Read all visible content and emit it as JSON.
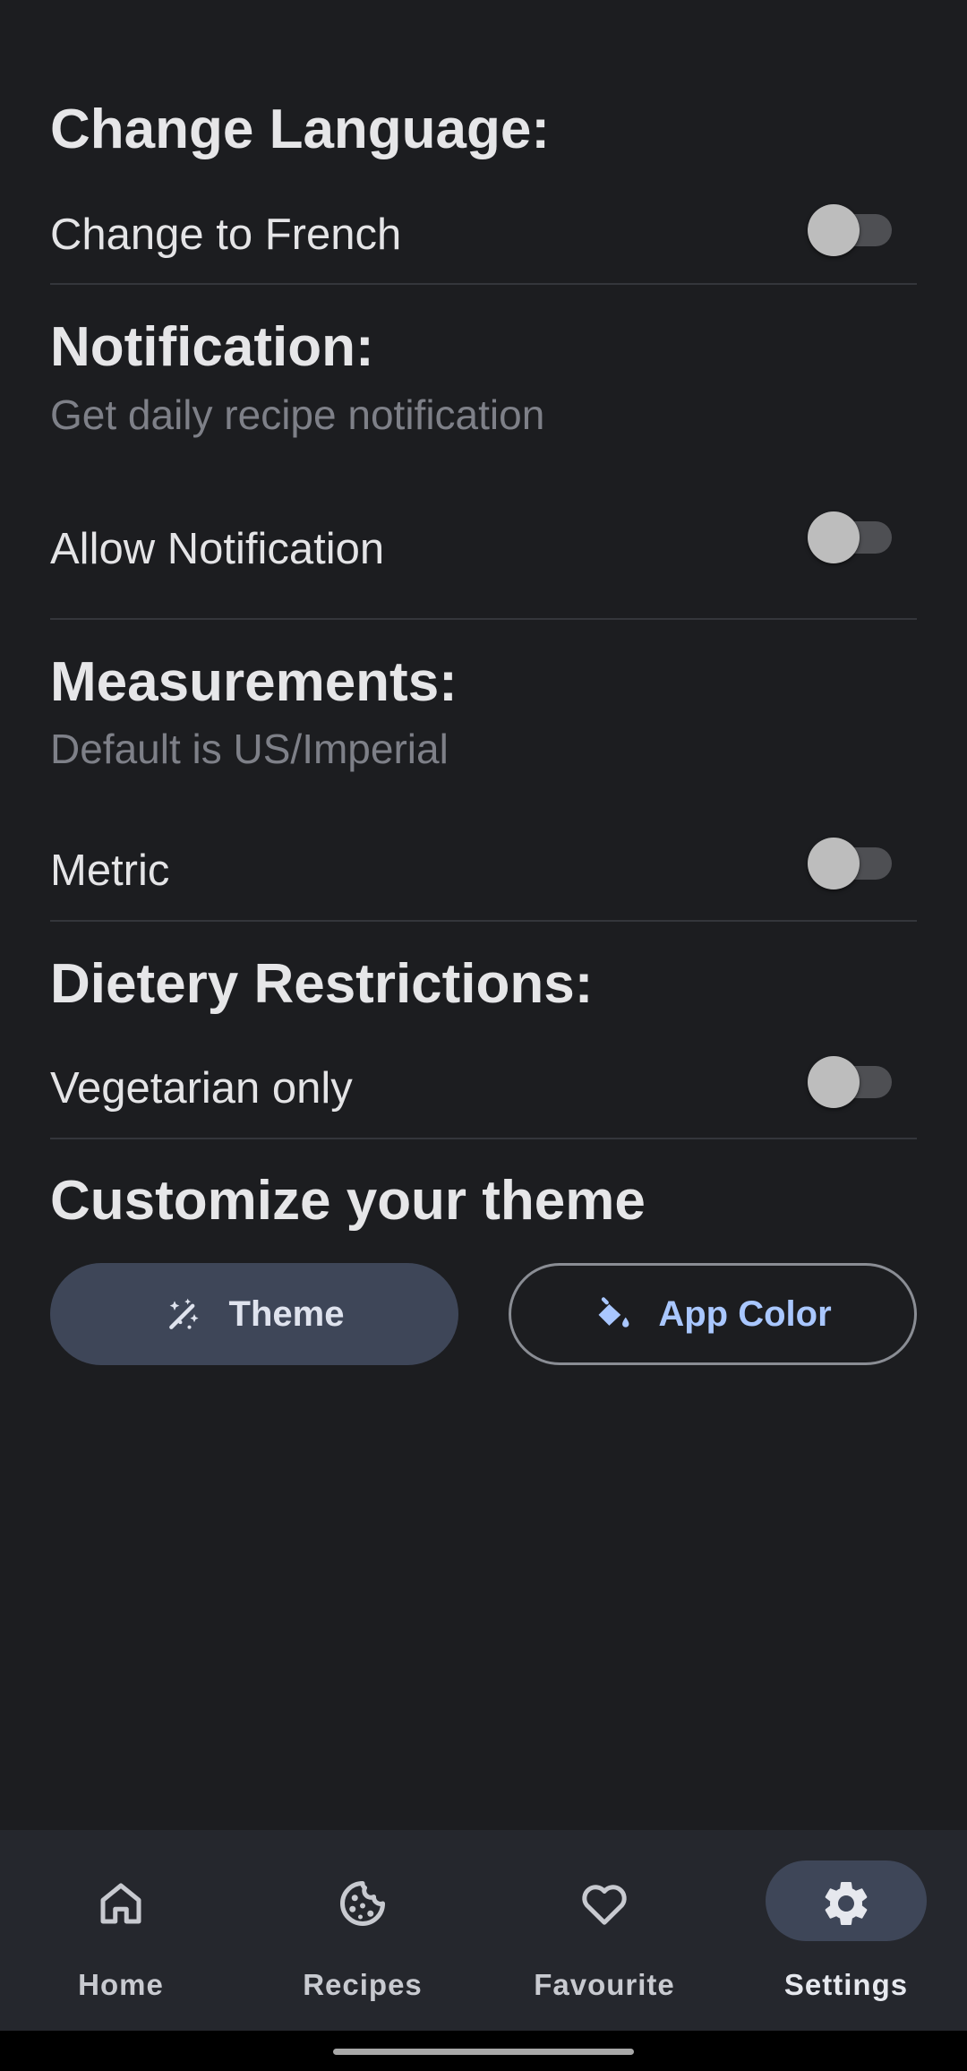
{
  "sections": {
    "language": {
      "title": "Change Language:",
      "row_label": "Change to French",
      "toggle_on": false
    },
    "notification": {
      "title": "Notification:",
      "subtitle": "Get daily recipe notification",
      "row_label": "Allow Notification",
      "toggle_on": false
    },
    "measurements": {
      "title": "Measurements:",
      "subtitle": "Default is US/Imperial",
      "row_label": "Metric",
      "toggle_on": false
    },
    "diet": {
      "title": "Dietery Restrictions:",
      "row_label": "Vegetarian only",
      "toggle_on": false
    },
    "theme": {
      "title": "Customize your theme",
      "theme_button": "Theme",
      "theme_button_icon": "magic-wand-icon",
      "color_button": "App Color",
      "color_button_icon": "paint-bucket-icon"
    }
  },
  "bottom_nav": {
    "items": [
      {
        "label": "Home",
        "icon": "home-icon",
        "active": false
      },
      {
        "label": "Recipes",
        "icon": "cookie-icon",
        "active": false
      },
      {
        "label": "Favourite",
        "icon": "heart-icon",
        "active": false
      },
      {
        "label": "Settings",
        "icon": "gear-icon",
        "active": true
      }
    ]
  },
  "colors": {
    "background": "#1c1d20",
    "accent": "#a9c7ff",
    "tonal_button": "#3e4658",
    "nav_background": "#25272d"
  }
}
